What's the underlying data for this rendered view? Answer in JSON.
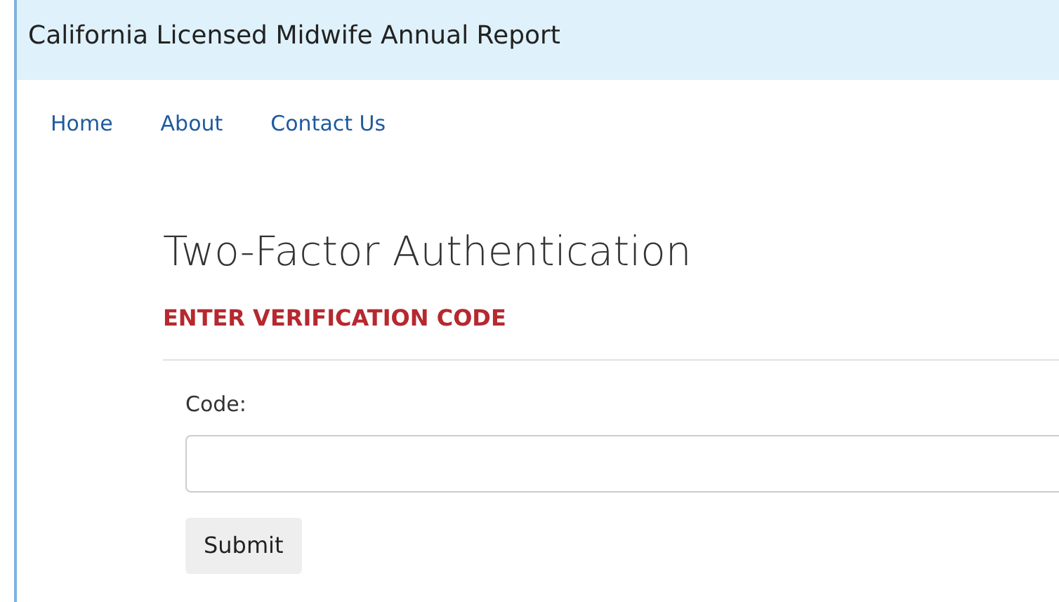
{
  "header": {
    "title": "California Licensed Midwife Annual Report"
  },
  "nav": [
    {
      "label": "Home"
    },
    {
      "label": "About"
    },
    {
      "label": "Contact Us"
    }
  ],
  "page_title": "Two-Factor Authentication",
  "section_heading": "ENTER VERIFICATION CODE",
  "form": {
    "label": "Code:",
    "submit": "Submit"
  }
}
